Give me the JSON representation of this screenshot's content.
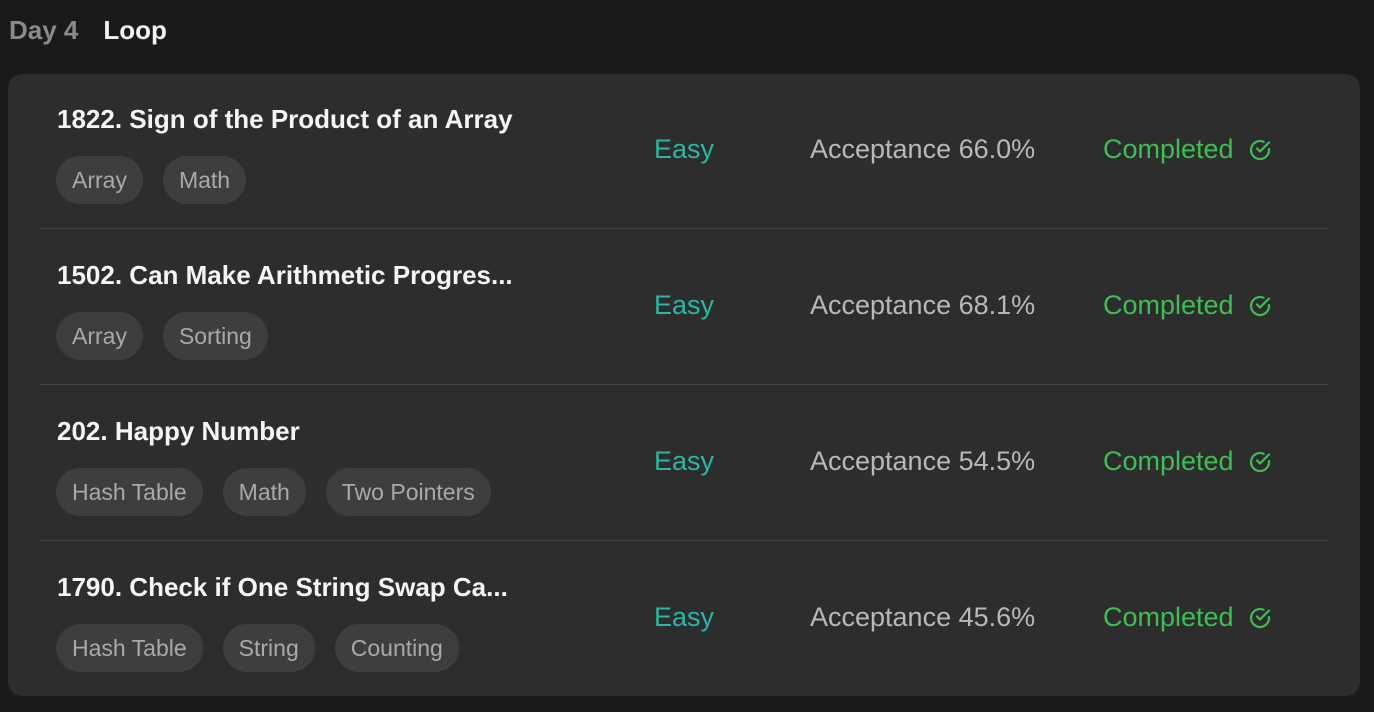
{
  "header": {
    "day_label": "Day 4",
    "topic": "Loop"
  },
  "colors": {
    "easy": "#2db5a3",
    "completed": "#3fbd55"
  },
  "problems": [
    {
      "title": "1822. Sign of the Product of an Array",
      "tags": [
        "Array",
        "Math"
      ],
      "difficulty": "Easy",
      "acceptance": "Acceptance 66.0%",
      "status": "Completed",
      "status_icon": "check-circle-icon"
    },
    {
      "title": "1502. Can Make Arithmetic Progres...",
      "tags": [
        "Array",
        "Sorting"
      ],
      "difficulty": "Easy",
      "acceptance": "Acceptance 68.1%",
      "status": "Completed",
      "status_icon": "check-circle-icon"
    },
    {
      "title": "202. Happy Number",
      "tags": [
        "Hash Table",
        "Math",
        "Two Pointers"
      ],
      "difficulty": "Easy",
      "acceptance": "Acceptance 54.5%",
      "status": "Completed",
      "status_icon": "check-circle-icon"
    },
    {
      "title": "1790. Check if One String Swap Ca...",
      "tags": [
        "Hash Table",
        "String",
        "Counting"
      ],
      "difficulty": "Easy",
      "acceptance": "Acceptance 45.6%",
      "status": "Completed",
      "status_icon": "check-circle-icon"
    }
  ]
}
